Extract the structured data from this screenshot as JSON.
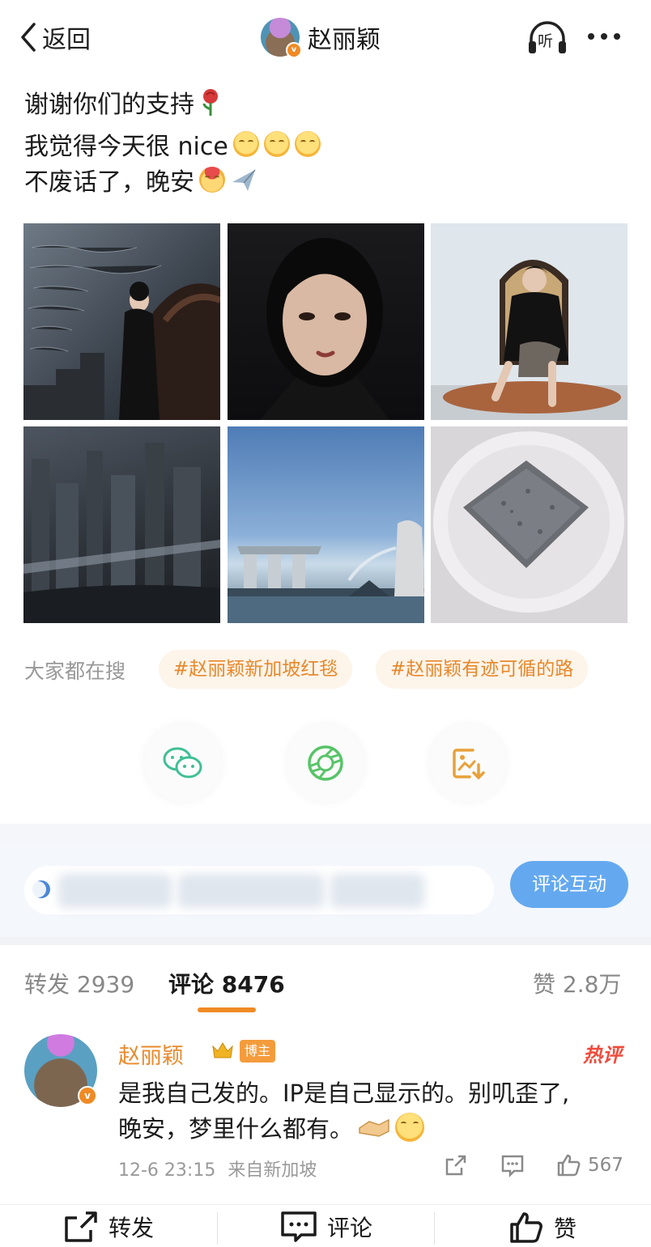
{
  "header": {
    "back_label": "返回",
    "user_name": "赵丽颖",
    "listen_label": "听"
  },
  "post": {
    "lines": [
      "谢谢你们的支持",
      "我觉得今天很 nice",
      "不废话了，晚安"
    ],
    "images": [
      {
        "subject": "woman in black dress on staircase with script wall"
      },
      {
        "subject": "close-up portrait of woman"
      },
      {
        "subject": "woman seated in rattan chair"
      },
      {
        "subject": "city skyline reflection through window"
      },
      {
        "subject": "Marina Bay Sands and Merlion skyline"
      },
      {
        "subject": "dark square pastry on white plate"
      }
    ]
  },
  "search": {
    "label": "大家都在搜",
    "tags": [
      "#赵丽颖新加坡红毯",
      "#赵丽颖有迹可循的路"
    ]
  },
  "share_buttons": [
    {
      "icon": "wechat-icon"
    },
    {
      "icon": "moments-icon"
    },
    {
      "icon": "save-image-icon"
    }
  ],
  "comment_bar": {
    "button_label": "评论互动"
  },
  "tabs": {
    "repost": "转发 2939",
    "comment": "评论 8476",
    "like": "赞 2.8万"
  },
  "comment": {
    "author": "赵丽颖",
    "author_badge": "博主",
    "hot_label": "热评",
    "lines": [
      "是我自己发的。IP是自己显示的。别叽歪了,",
      "晚安，梦里什么都有。"
    ],
    "time": "12-6 23:15",
    "source": "来自新加坡",
    "like_count": "567"
  },
  "bottom_bar": {
    "repost": "转发",
    "comment": "评论",
    "like": "赞"
  },
  "colors": {
    "accent": "#f08a24",
    "tag_bg": "#fdf4ea",
    "button_blue": "#64a9f0",
    "hot_red": "#f04b3b"
  }
}
